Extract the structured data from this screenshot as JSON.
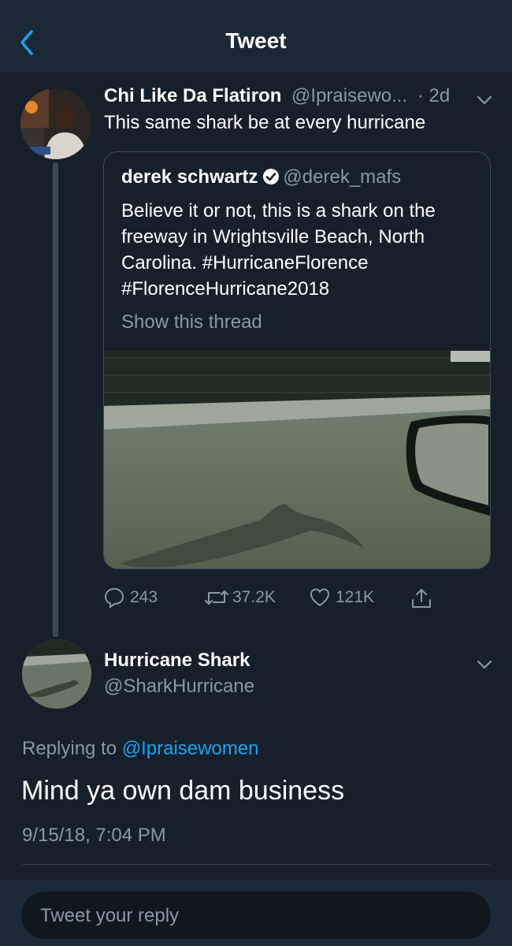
{
  "header": {
    "title": "Tweet"
  },
  "icons": {
    "back": "chevron-left-icon",
    "verified": "verified-badge-icon",
    "caret": "chevron-down-icon",
    "reply": "reply-bubble-icon",
    "retweet": "retweet-icon",
    "like": "heart-icon",
    "share": "share-icon"
  },
  "colors": {
    "background": "#15202b",
    "header": "#1b2836",
    "link": "#1da1f2",
    "muted": "#8899a6"
  },
  "tweet1": {
    "name": "Chi Like Da Flatiron",
    "handle": "@Ipraisewo...",
    "time": "· 2d",
    "text": "This same shark be at every hurricane",
    "quote": {
      "name": "derek schwartz",
      "handle": "@derek_mafs",
      "text": "Believe it or not, this is a shark on the freeway in Wrightsville Beach, North Carolina. #HurricaneFlorence #FlorenceHurricane2018",
      "show_thread": "Show this thread"
    },
    "stats": {
      "replies": "243",
      "retweets": "37.2K",
      "likes": "121K"
    }
  },
  "tweet2": {
    "name": "Hurricane Shark",
    "handle": "@SharkHurricane",
    "replying_prefix": "Replying to",
    "replying_to": "@Ipraisewomen",
    "text": "Mind ya own dam business",
    "timestamp": "9/15/18, 7:04 PM"
  },
  "reply_box": {
    "placeholder": "Tweet your reply"
  }
}
